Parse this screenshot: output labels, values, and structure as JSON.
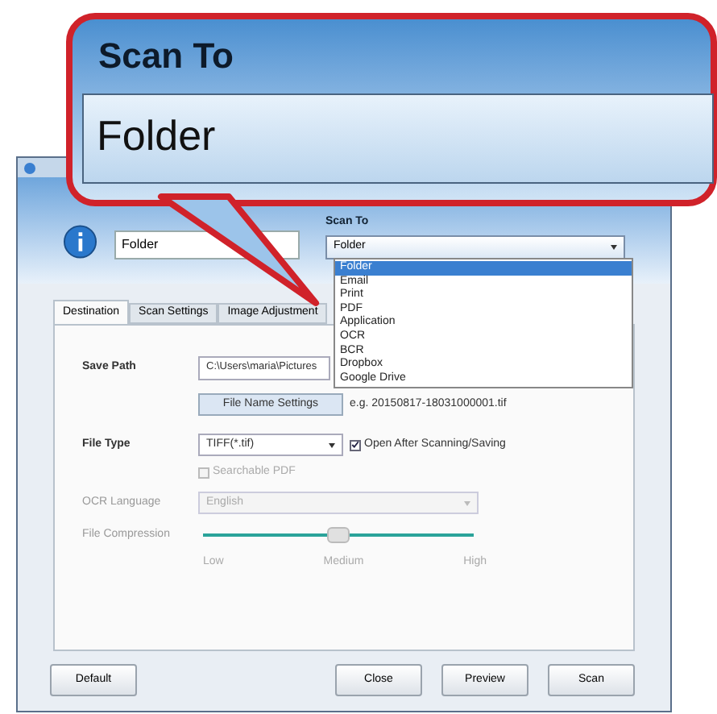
{
  "callout": {
    "title": "Scan To",
    "value": "Folder"
  },
  "header": {
    "profile_name": "Folder",
    "scan_to_label": "Scan To",
    "scan_to_value": "Folder",
    "options": [
      {
        "label": "Folder",
        "selected": true
      },
      {
        "label": "Email",
        "selected": false
      },
      {
        "label": "Print",
        "selected": false
      },
      {
        "label": "PDF",
        "selected": false
      },
      {
        "label": "Application",
        "selected": false
      },
      {
        "label": "OCR",
        "selected": false
      },
      {
        "label": "BCR",
        "selected": false
      },
      {
        "label": "Dropbox",
        "selected": false
      },
      {
        "label": "Google Drive",
        "selected": false
      }
    ]
  },
  "tabs": [
    {
      "label": "Destination",
      "selected": true
    },
    {
      "label": "Scan Settings",
      "selected": false
    },
    {
      "label": "Image Adjustment",
      "selected": false
    }
  ],
  "destination": {
    "save_path_label": "Save Path",
    "save_path": "C:\\Users\\maria\\Pictures",
    "file_name_button": "File Name Settings",
    "file_name_example": "e.g. 20150817-18031000001.tif",
    "file_type_label": "File Type",
    "file_type": "TIFF(*.tif)",
    "open_after": {
      "label": "Open After Scanning/Saving",
      "checked": true,
      "disabled": false
    },
    "searchable_pdf": {
      "label": "Searchable PDF",
      "checked": false,
      "disabled": true
    },
    "ocr_language": {
      "label": "OCR Language",
      "value": "English",
      "disabled": true
    },
    "compression": {
      "label": "File Compression",
      "level": 0.5,
      "disabled": true,
      "ticks": [
        "Low",
        "Medium",
        "High"
      ]
    }
  },
  "buttons": [
    {
      "label": "Default",
      "kind": "left"
    },
    {
      "label": "Close",
      "kind": "right"
    },
    {
      "label": "Preview",
      "kind": "right"
    },
    {
      "label": "Scan",
      "kind": "right"
    }
  ]
}
